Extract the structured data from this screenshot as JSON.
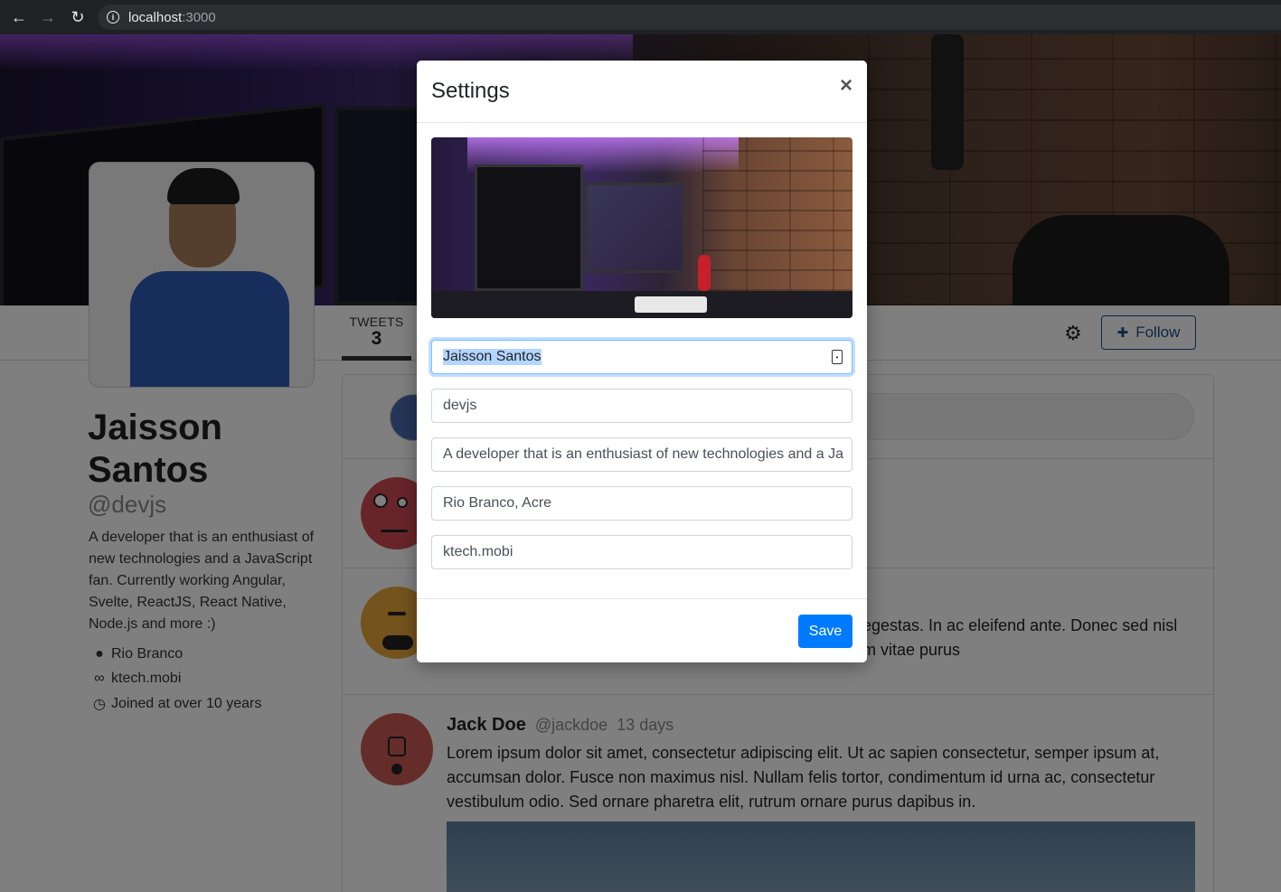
{
  "browser": {
    "url_host": "localhost",
    "url_port": ":3000"
  },
  "profile": {
    "name": "Jaisson Santos",
    "handle": "@devjs",
    "bio": "A developer that is an enthusiast of new technologies and a JavaScript fan. Currently working Angular, Svelte, ReactJS, React Native, Node.js and more :)",
    "location": "Rio Branco",
    "website": "ktech.mobi",
    "joined": "Joined at over 10 years"
  },
  "tabs": [
    {
      "label": "TWEETS",
      "count": "3"
    }
  ],
  "actions": {
    "follow_label": "Follow"
  },
  "posts": [
    {
      "text_visible": "."
    },
    {
      "text_line1": "egestas. In ac eleifend ante. Donec sed nisl",
      "text_line2": "m vitae purus"
    },
    {
      "author": "Jack Doe",
      "handle": "@jackdoe",
      "time": "13 days",
      "text": "Lorem ipsum dolor sit amet, consectetur adipiscing elit. Ut ac sapien consectetur, semper ipsum at, accumsan dolor. Fusce non maximus nisl. Nullam felis tortor, condimentum id urna ac, consectetur vestibulum odio. Sed ornare pharetra elit, rutrum ornare purus dapibus in."
    }
  ],
  "modal": {
    "title": "Settings",
    "close_symbol": "×",
    "fields": {
      "name": "Jaisson Santos",
      "username": "devjs",
      "bio": "A developer that is an enthusiast of new technologies and a Ja",
      "location": "Rio Branco, Acre",
      "website": "ktech.mobi"
    },
    "save_label": "Save"
  },
  "colors": {
    "primary": "#007bff",
    "follow": "#1d4f8c",
    "overlay": "rgba(0,0,0,0.5)"
  }
}
